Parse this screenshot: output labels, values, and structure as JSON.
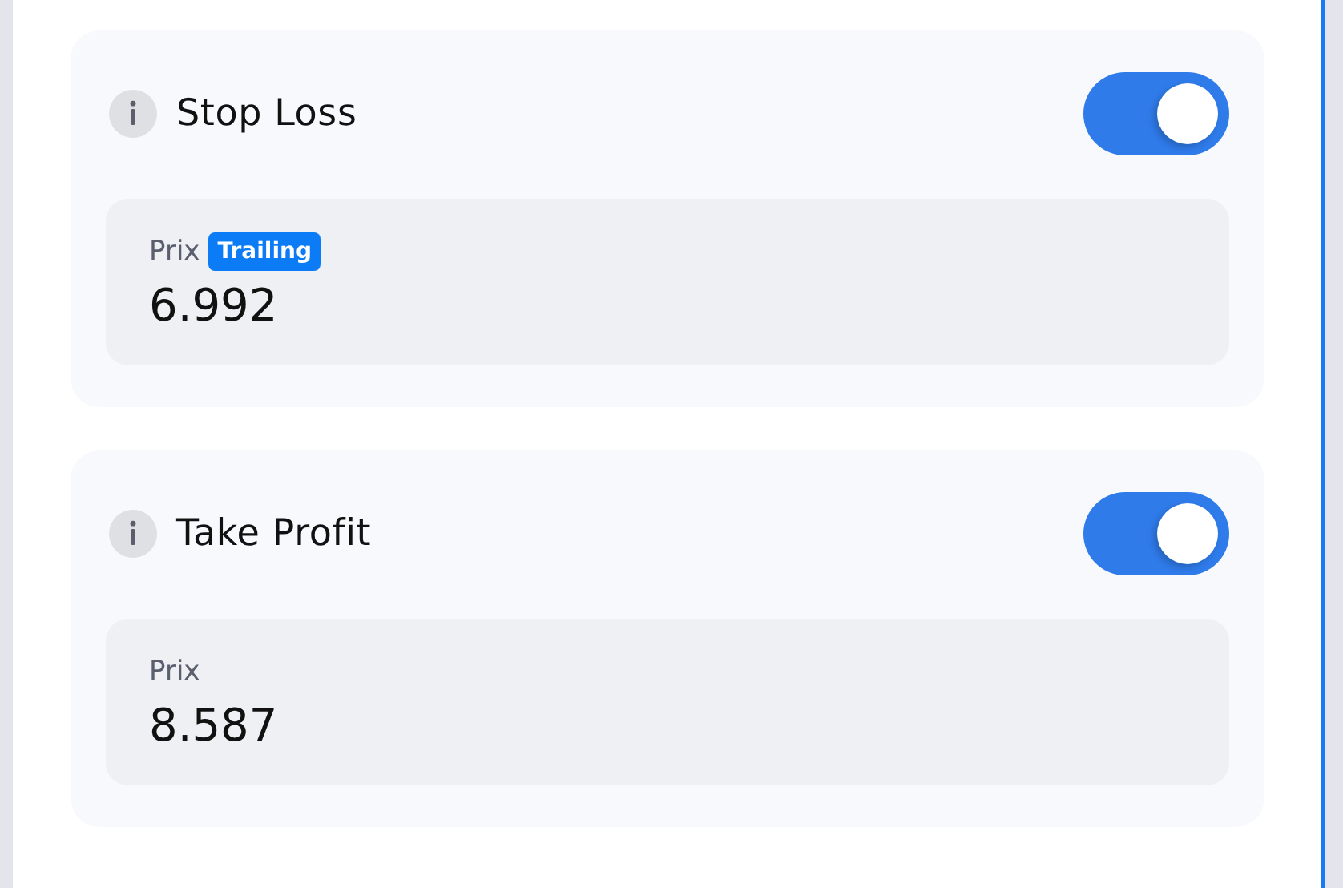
{
  "sections": [
    {
      "title": "Stop Loss",
      "enabled": true,
      "field": {
        "label": "Prix",
        "badge": "Trailing",
        "value": "6.992"
      }
    },
    {
      "title": "Take Profit",
      "enabled": true,
      "field": {
        "label": "Prix",
        "value": "8.587"
      }
    }
  ]
}
